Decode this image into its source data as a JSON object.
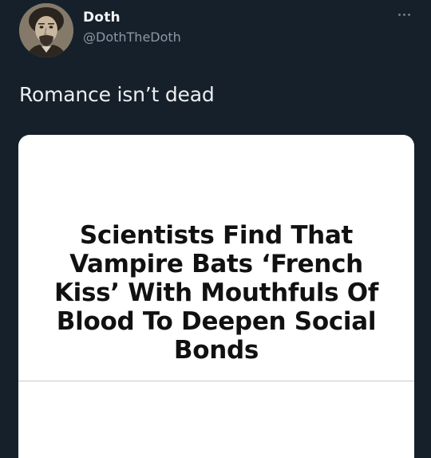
{
  "tweet": {
    "author": {
      "display_name": "Doth",
      "handle": "@DothTheDoth",
      "avatar_icon": "avatar-portrait-icon"
    },
    "more_icon": "more-horizontal-icon",
    "text": "Romance isn’t dead",
    "card": {
      "headline": "Scientists Find That Vampire Bats ‘French Kiss’ With Mouthfuls Of Blood To Deepen Social Bonds"
    }
  },
  "colors": {
    "background": "#15202b",
    "primary_text": "#e7e9ea",
    "secondary_text": "#8b98a5",
    "card_background": "#ffffff",
    "headline_text": "#111111"
  }
}
